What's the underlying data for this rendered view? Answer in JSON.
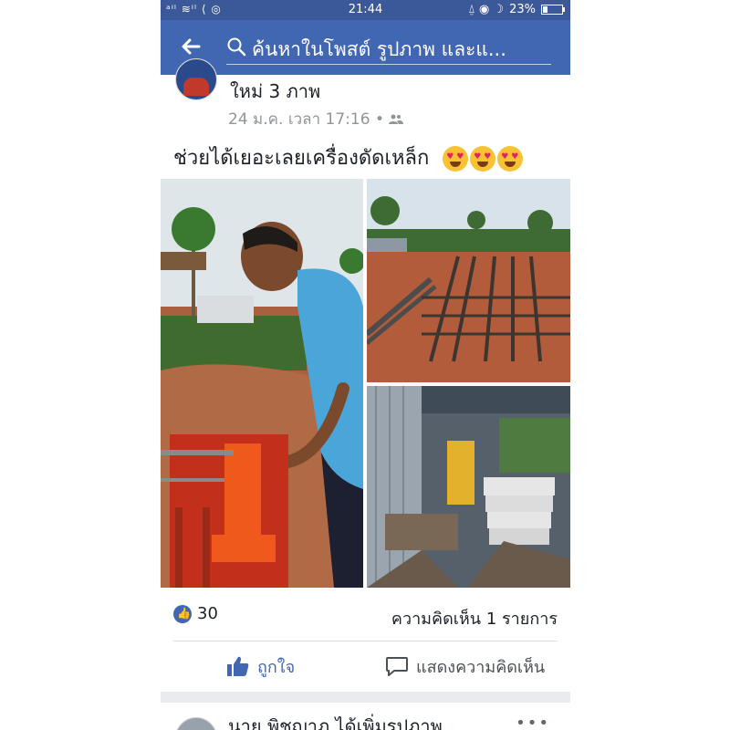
{
  "status_bar": {
    "left_icons": "ᵃᴵˡ ≋ᴵˡ ⟨ ◎",
    "time": "21:44",
    "right_icons": "⍙ ◉ ☽",
    "battery": "23%"
  },
  "search": {
    "placeholder": "ค้นหาในโพสต์ รูปภาพ และแ..."
  },
  "post": {
    "title": "ใหม่ 3 ภาพ",
    "meta": "24 ม.ค. เวลา 17:16 •",
    "text": "ช่วยได้เยอะเลยเครื่องดัดเหล็ก",
    "likes": "30",
    "comments": "ความคิดเห็น 1 รายการ",
    "like_label": "ถูกใจ",
    "comment_label": "แสดงความคิดเห็น"
  },
  "next_post": {
    "text": "นาย พิชญาภ ได้เพิ่มรูปภาพ",
    "menu": "•••"
  },
  "colors": {
    "brand": "#4267b2",
    "status": "#3b5998"
  }
}
